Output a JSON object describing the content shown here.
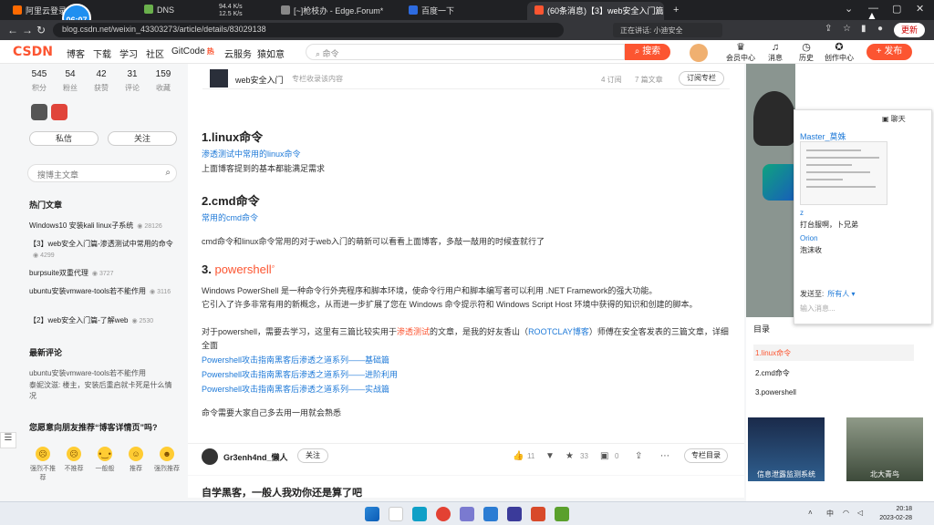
{
  "browser": {
    "tabs": [
      {
        "label": "阿里云登录页"
      },
      {
        "label": "DNS"
      },
      {
        "label": "[~]枪枝办 - Edge.Forum*"
      },
      {
        "label": "百度一下"
      },
      {
        "label": "(60条消息)【3】web安全入门篇"
      }
    ],
    "net_speed_up": "94.4 K/s",
    "net_speed_down": "12.5 K/s",
    "time_bubble": "06:07",
    "url": "blog.csdn.net/weixin_43303273/article/details/83029138",
    "speaking_label": "正在讲话: 小迪安全",
    "update_label": "更新"
  },
  "csdn": {
    "logo": "CSDN",
    "nav": [
      "博客",
      "下载",
      "学习",
      "社区",
      "GitCode",
      "云服务",
      "猿如意"
    ],
    "hot_badge": "hot",
    "search_placeholder": "命令",
    "search_btn": "搜索",
    "header_icons": [
      "会员中心",
      "消息",
      "历史",
      "创作中心"
    ],
    "publish_btn": "发布"
  },
  "sidebar": {
    "stats": [
      {
        "value": "545",
        "label": "积分"
      },
      {
        "value": "54",
        "label": "粉丝"
      },
      {
        "value": "42",
        "label": "获赞"
      },
      {
        "value": "31",
        "label": "评论"
      },
      {
        "value": "159",
        "label": "收藏"
      }
    ],
    "msg_btn": "私信",
    "follow_btn": "关注",
    "search_placeholder": "搜博主文章",
    "hot_title": "热门文章",
    "hot_articles": [
      {
        "title": "Windows10 安装kali linux子系统",
        "views": "28126"
      },
      {
        "title": "【3】web安全入门篇-渗透测试中常用的命令",
        "views": "4299"
      },
      {
        "title": "burpsuite双重代理",
        "views": "3727"
      },
      {
        "title": "ubuntu安装vmware-tools若不能作用",
        "views": "3116"
      },
      {
        "title": "【2】web安全入门篇-了解web",
        "views": "2530"
      }
    ],
    "comments_title": "最新评论",
    "comment_1": "ubuntu安装vmware-tools若不能作用",
    "comment_2": "泰妮汶滋: 楼主，安装后重启就卡死是什么情况",
    "recommend_q": "您愿意向朋友推荐“博客详情页”吗?",
    "emojis": [
      "强烈不推荐",
      "不推荐",
      "一般般",
      "推荐",
      "强烈推荐"
    ]
  },
  "article": {
    "column_name": "web安全入门",
    "column_meta": "专栏收录该内容",
    "subs": "4 订阅",
    "count": "7 篇文章",
    "sub_btn": "订阅专栏",
    "h1": "1.linux命令",
    "h1_link": "渗透测试中常用的linux命令",
    "h1_text": "上面博客提到的基本都能满足需求",
    "h2": "2.cmd命令",
    "h2_link": "常用的cmd命令",
    "cmd_text": "cmd命令和linux命令常用的对于web入门的萌新可以看看上面博客，多敲一敲用的时候查就行了",
    "h3_num": "3.",
    "h3_word": "powershell",
    "ps_text_1": "Windows PowerShell 是一种命令行外壳程序和脚本环境，使命令行用户和脚本编写者可以利用 .NET Framework的强大功能。",
    "ps_text_2": "它引入了许多非常有用的新概念，从而进一步扩展了您在 Windows 命令提示符和 Windows Script Host 环境中获得的知识和创建的脚本。",
    "ps_text_3a": "对于powershell，需要去学习，这里有三篇比较实用于",
    "ps_text_3b": "渗透测试",
    "ps_text_3c": "的文章，是我的好友香山（",
    "ps_text_3d": "ROOTCLAY博客",
    "ps_text_3e": "）师傅在安全客发表的三篇文章，详细全面",
    "ps_links": [
      "Powershell攻击指南黑客后渗透之道系列——基础篇",
      "Powershell攻击指南黑客后渗透之道系列——进阶利用",
      "Powershell攻击指南黑客后渗透之道系列——实战篇"
    ],
    "closing": "命令需要大家自己多去用一用就会熟悉",
    "author": "Gr3enh4nd_懒人",
    "follow": "关注",
    "likes": "11",
    "stars": "33",
    "comments": "0",
    "column_dir": "专栏目录",
    "next_title": "自学黑客，一般人我劝你还是算了吧"
  },
  "right": {
    "chat_title": "聊天",
    "chat_name": "Master_莫姝",
    "msg1_name": "z",
    "msg1_text": "打台服啊，卜兄弟",
    "msg2_name": "Orion",
    "msg2_text": "泡沫收",
    "send_to_label": "发送至:",
    "send_to_value": "所有人 ▾",
    "input_placeholder": "输入消息...",
    "toc_title": "目录",
    "toc_items": [
      "1.linux命令",
      "2.cmd命令",
      "3.powershell"
    ],
    "thumbs": [
      "信息泄露监测系统",
      "北大青鸟"
    ]
  },
  "taskbar": {
    "time": "20:18",
    "date": "2023-02-28"
  }
}
